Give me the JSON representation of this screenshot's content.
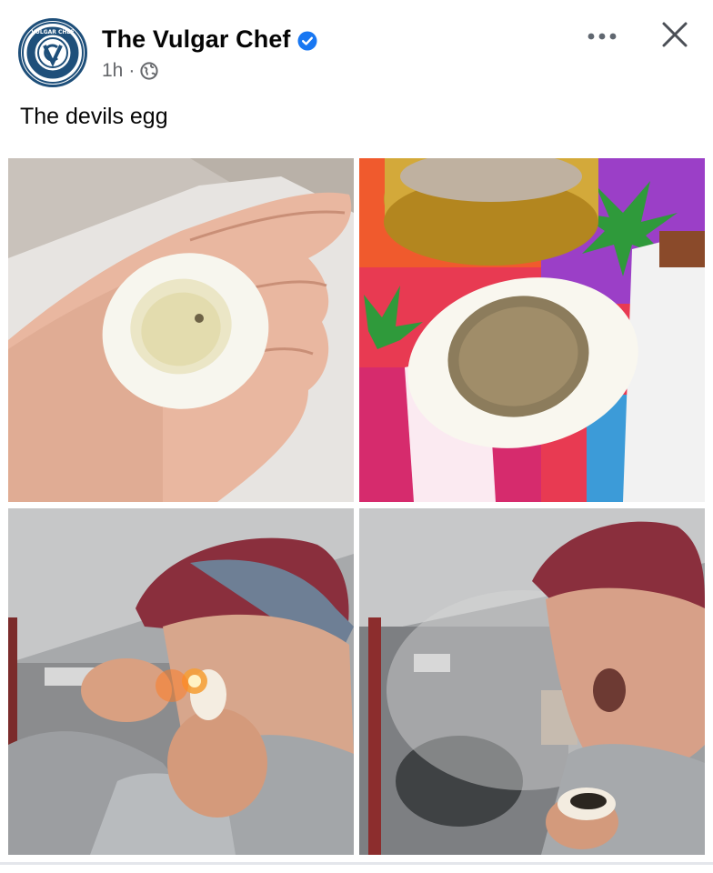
{
  "post": {
    "page_name": "The Vulgar Chef",
    "time": "1h",
    "separator": "·",
    "audience_icon": "globe-icon",
    "verified_icon": "verified-badge-icon",
    "caption": "The devils egg",
    "logo_text": "VULGAR CHEF"
  },
  "actions": {
    "more_icon": "more-horizontal-icon",
    "close_icon": "close-icon"
  },
  "photos": [
    {
      "name": "hollowed-egg-in-hand-photo"
    },
    {
      "name": "egg-filled-with-herb-photo"
    },
    {
      "name": "man-lighting-egg-pipe-photo"
    },
    {
      "name": "man-exhaling-smoke-photo"
    }
  ],
  "colors": {
    "text_primary": "#050505",
    "text_secondary": "#65676b",
    "verified_blue": "#1877f2",
    "logo_navy": "#1e4f7a"
  }
}
